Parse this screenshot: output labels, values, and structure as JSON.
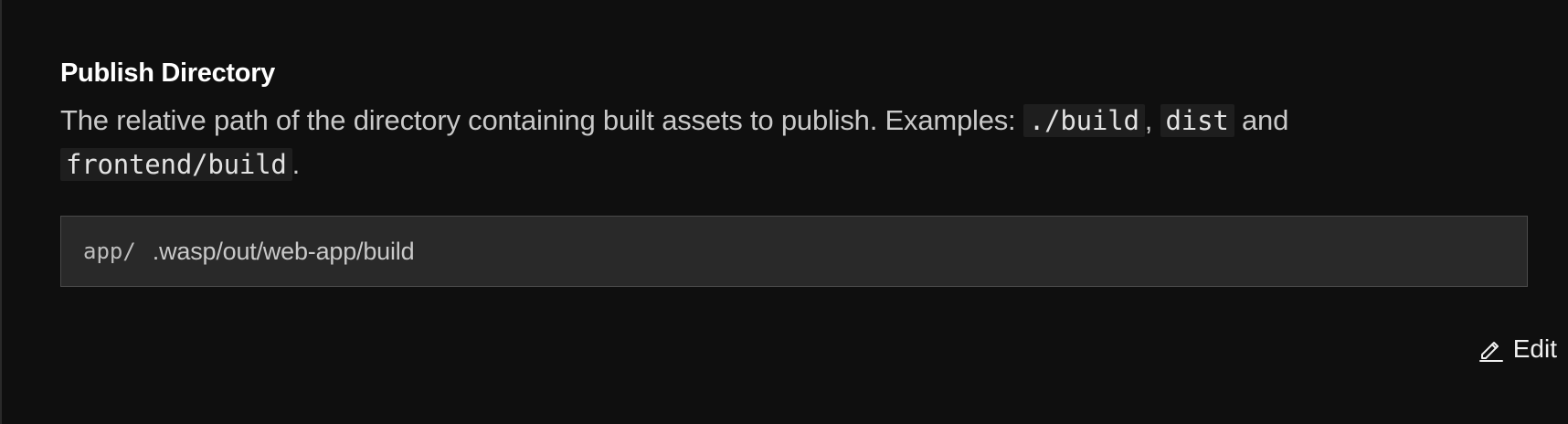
{
  "section": {
    "title": "Publish Directory",
    "description_part1": "The relative path of the directory containing built assets to publish. Examples: ",
    "example1": "./build",
    "sep1": ", ",
    "example2": "dist",
    "sep2": " and",
    "example3": "frontend/build",
    "end": "."
  },
  "field": {
    "prefix": "app/",
    "value": ".wasp/out/web-app/build"
  },
  "actions": {
    "edit_label": "Edit",
    "edit_icon": "pencil-icon"
  },
  "colors": {
    "background": "#0f0f0f",
    "field_bg": "#292929",
    "field_border": "#4a4a4a",
    "text": "#e6e6e6"
  }
}
